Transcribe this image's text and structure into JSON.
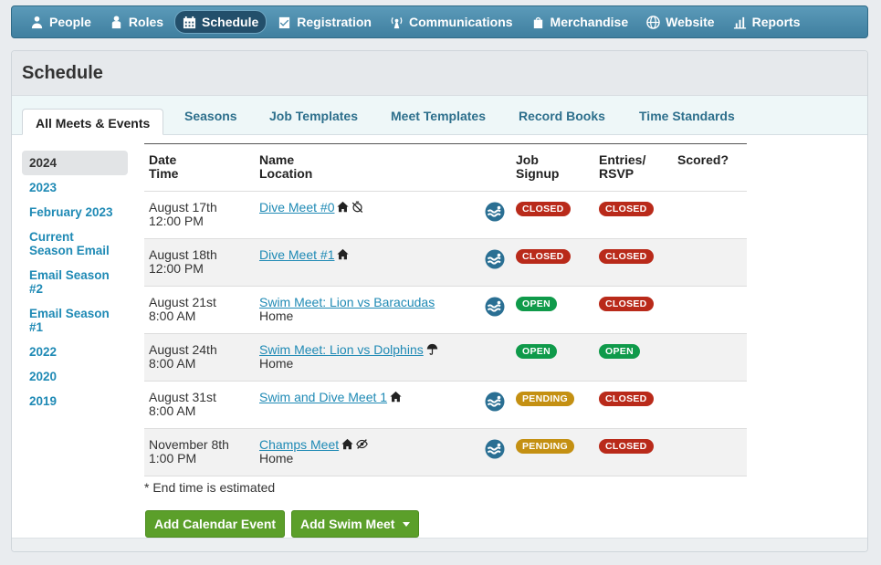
{
  "nav": {
    "items": [
      {
        "label": "People",
        "icon": "person-icon"
      },
      {
        "label": "Roles",
        "icon": "roles-icon"
      },
      {
        "label": "Schedule",
        "icon": "calendar-icon",
        "active": true
      },
      {
        "label": "Registration",
        "icon": "checklist-icon"
      },
      {
        "label": "Communications",
        "icon": "broadcast-icon"
      },
      {
        "label": "Merchandise",
        "icon": "shopping-bag-icon"
      },
      {
        "label": "Website",
        "icon": "globe-icon"
      },
      {
        "label": "Reports",
        "icon": "bar-chart-icon"
      }
    ]
  },
  "page": {
    "title": "Schedule"
  },
  "tabs": [
    {
      "label": "All Meets & Events",
      "active": true
    },
    {
      "label": "Seasons"
    },
    {
      "label": "Job Templates"
    },
    {
      "label": "Meet Templates"
    },
    {
      "label": "Record Books"
    },
    {
      "label": "Time Standards"
    }
  ],
  "seasons": [
    {
      "label": "2024",
      "active": true
    },
    {
      "label": "2023"
    },
    {
      "label": "February 2023"
    },
    {
      "label": "Current Season Email"
    },
    {
      "label": "Email Season #2"
    },
    {
      "label": "Email Season #1"
    },
    {
      "label": "2022"
    },
    {
      "label": "2020"
    },
    {
      "label": "2019"
    }
  ],
  "table": {
    "headers": {
      "date": "Date",
      "time": "Time",
      "name": "Name",
      "location": "Location",
      "job1": "Job",
      "job2": "Signup",
      "entries1": "Entries/",
      "entries2": "RSVP",
      "scored": "Scored?"
    },
    "rows": [
      {
        "date": "August 17th",
        "time": "12:00 PM",
        "name": "Dive Meet #0",
        "location": "",
        "icons": [
          "home-icon",
          "timer-off-icon"
        ],
        "swim_logo": true,
        "job": "CLOSED",
        "entries": "CLOSED"
      },
      {
        "date": "August 18th",
        "time": "12:00 PM",
        "name": "Dive Meet #1",
        "location": "",
        "icons": [
          "home-icon"
        ],
        "swim_logo": true,
        "job": "CLOSED",
        "entries": "CLOSED"
      },
      {
        "date": "August 21st",
        "time": "8:00 AM",
        "name": "Swim Meet: Lion vs Baracudas",
        "location": "Home",
        "icons": [],
        "swim_logo": true,
        "job": "OPEN",
        "entries": "CLOSED"
      },
      {
        "date": "August 24th",
        "time": "8:00 AM",
        "name": "Swim Meet: Lion vs Dolphins",
        "location": "Home",
        "icons": [
          "umbrella-icon"
        ],
        "swim_logo": false,
        "job": "OPEN",
        "entries": "OPEN"
      },
      {
        "date": "August 31st",
        "time": "8:00 AM",
        "name": "Swim and Dive Meet 1",
        "location": "",
        "icons": [
          "home-icon"
        ],
        "swim_logo": true,
        "job": "PENDING",
        "entries": "CLOSED"
      },
      {
        "date": "November 8th",
        "time": "1:00 PM",
        "name": "Champs Meet",
        "location": "Home",
        "icons": [
          "home-icon",
          "eye-slash-icon"
        ],
        "swim_logo": true,
        "job": "PENDING",
        "entries": "CLOSED"
      }
    ]
  },
  "note": "* End time is estimated",
  "buttons": {
    "add_calendar": "Add Calendar Event",
    "add_swim_meet": "Add Swim Meet"
  }
}
